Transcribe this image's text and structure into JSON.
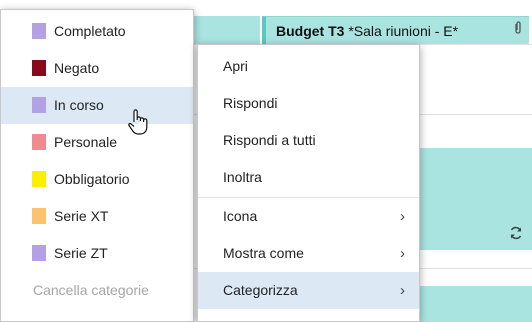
{
  "event": {
    "title_bold": "Budget T3",
    "title_rest": " *Sala riunioni - E*",
    "attachment_icon": "paperclip-icon"
  },
  "categories_menu": {
    "items": [
      {
        "label": "Completato",
        "color": "#b4a0e5"
      },
      {
        "label": "Negato",
        "color": "#8b0a1a"
      },
      {
        "label": "In corso",
        "color": "#b4a0e5"
      },
      {
        "label": "Personale",
        "color": "#f08a8f"
      },
      {
        "label": "Obbligatorio",
        "color": "#ffee00"
      },
      {
        "label": "Serie XT",
        "color": "#fcc26e"
      },
      {
        "label": "Serie ZT",
        "color": "#b4a0e5"
      }
    ],
    "clear_label": "Cancella categorie"
  },
  "context_menu": {
    "items": [
      {
        "label": "Apri"
      },
      {
        "label": "Rispondi"
      },
      {
        "label": "Rispondi a tutti"
      },
      {
        "label": "Inoltra"
      },
      {
        "label": "Icona",
        "submenu": true
      },
      {
        "label": "Mostra come",
        "submenu": true
      },
      {
        "label": "Categorizza",
        "submenu": true
      }
    ],
    "chevron": "›"
  }
}
